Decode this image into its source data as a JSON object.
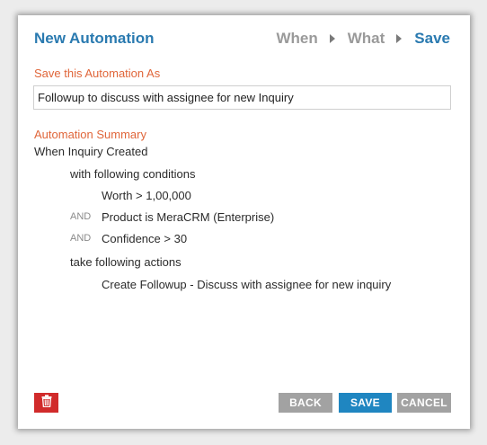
{
  "header": {
    "title": "New Automation",
    "steps": [
      {
        "label": "When",
        "active": false
      },
      {
        "label": "What",
        "active": false
      },
      {
        "label": "Save",
        "active": true
      }
    ]
  },
  "save_section": {
    "label": "Save this Automation As",
    "input_value": "Followup to discuss with assignee for new Inquiry"
  },
  "summary": {
    "label": "Automation Summary",
    "trigger": "When Inquiry Created",
    "conditions_intro": "with following conditions",
    "conditions": [
      {
        "joiner": "",
        "text": "Worth > 1,00,000"
      },
      {
        "joiner": "AND",
        "text": "Product is MeraCRM (Enterprise)"
      },
      {
        "joiner": "AND",
        "text": "Confidence > 30"
      }
    ],
    "actions_intro": "take following actions",
    "actions": [
      "Create Followup - Discuss with assignee for new inquiry"
    ]
  },
  "footer": {
    "delete_icon": "trash-icon",
    "back_label": "BACK",
    "save_label": "SAVE",
    "cancel_label": "CANCEL"
  },
  "colors": {
    "accent_blue": "#2a7ab0",
    "section_orange": "#e0663a",
    "delete_red": "#d12b2b",
    "save_button": "#1f86c1",
    "neutral_button": "#a2a2a2"
  }
}
